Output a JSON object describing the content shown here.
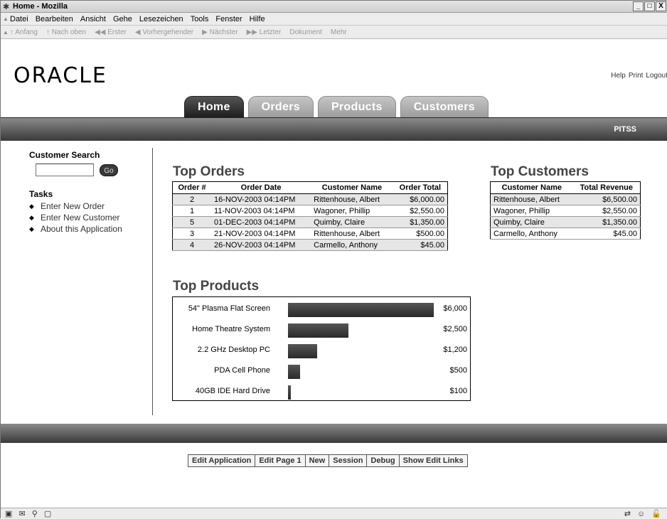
{
  "window": {
    "title": "Home - Mozilla",
    "min": "_",
    "max": "□",
    "close": "X"
  },
  "menu": [
    "Datei",
    "Bearbeiten",
    "Ansicht",
    "Gehe",
    "Lesezeichen",
    "Tools",
    "Fenster",
    "Hilfe"
  ],
  "nav": [
    "↑ Anfang",
    "↑ Nach oben",
    "◀◀ Erster",
    "◀ Vorhergehender",
    "▶ Nächster",
    "▶▶ Letzter",
    "Dokument",
    "Mehr"
  ],
  "logo": "ORACLE",
  "utils": [
    "Help",
    "Print",
    "Logout"
  ],
  "tabs": [
    "Home",
    "Orders",
    "Products",
    "Customers"
  ],
  "user": "PITSS",
  "sidebar": {
    "search_title": "Customer Search",
    "go": "Go",
    "tasks_title": "Tasks",
    "tasks": [
      "Enter New Order",
      "Enter New Customer",
      "About this Application"
    ]
  },
  "top_orders": {
    "title": "Top Orders",
    "headers": [
      "Order #",
      "Order Date",
      "Customer Name",
      "Order Total"
    ],
    "rows": [
      [
        "2",
        "16-NOV-2003 04:14PM",
        "Rittenhouse, Albert",
        "$6,000.00"
      ],
      [
        "1",
        "11-NOV-2003 04:14PM",
        "Wagoner, Phillip",
        "$2,550.00"
      ],
      [
        "5",
        "01-DEC-2003 04:14PM",
        "Quimby, Claire",
        "$1,350.00"
      ],
      [
        "3",
        "21-NOV-2003 04:14PM",
        "Rittenhouse, Albert",
        "$500.00"
      ],
      [
        "4",
        "26-NOV-2003 04:14PM",
        "Carmello, Anthony",
        "$45.00"
      ]
    ]
  },
  "top_customers": {
    "title": "Top Customers",
    "headers": [
      "Customer Name",
      "Total Revenue"
    ],
    "rows": [
      [
        "Rittenhouse, Albert",
        "$6,500.00"
      ],
      [
        "Wagoner, Phillip",
        "$2,550.00"
      ],
      [
        "Quimby, Claire",
        "$1,350.00"
      ],
      [
        "Carmello, Anthony",
        "$45.00"
      ]
    ]
  },
  "top_products": {
    "title": "Top Products",
    "items": [
      {
        "name": "54\" Plasma Flat Screen",
        "value": 6000,
        "label": "$6,000"
      },
      {
        "name": "Home Theatre System",
        "value": 2500,
        "label": "$2,500"
      },
      {
        "name": "2.2 GHz Desktop PC",
        "value": 1200,
        "label": "$1,200"
      },
      {
        "name": "PDA Cell Phone",
        "value": 500,
        "label": "$500"
      },
      {
        "name": "40GB IDE Hard Drive",
        "value": 100,
        "label": "$100"
      }
    ]
  },
  "devbar": [
    "Edit Application",
    "Edit Page 1",
    "New",
    "Session",
    "Debug",
    "Show Edit Links"
  ],
  "status": {
    "left_icons": "▣ ✉ ⚲ ▢",
    "right_icons": "⇄ ☺ 🔓"
  }
}
